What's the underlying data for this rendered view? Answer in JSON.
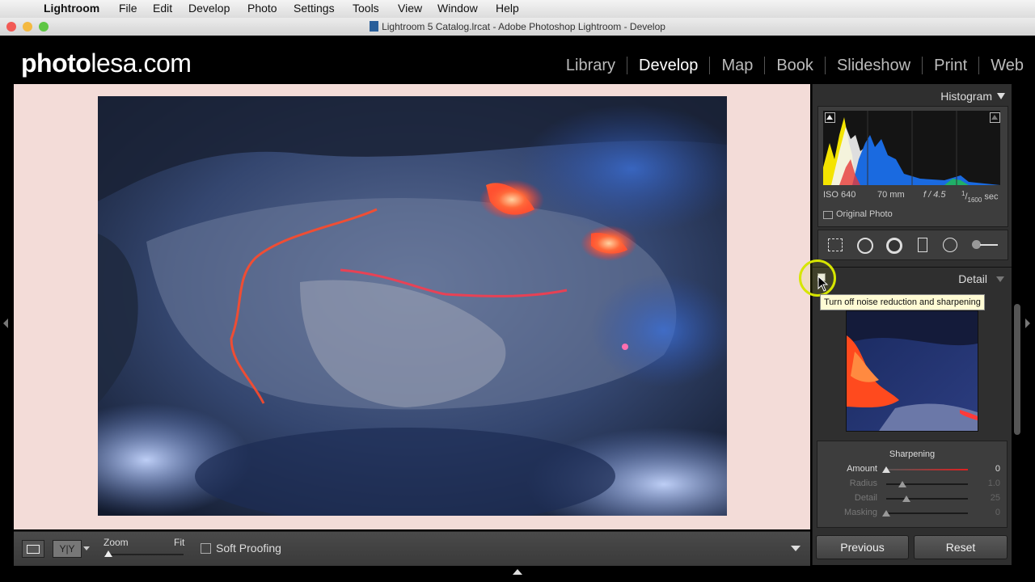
{
  "menubar": {
    "app_name": "Lightroom",
    "items": [
      "File",
      "Edit",
      "Develop",
      "Photo",
      "Settings",
      "Tools",
      "View",
      "Window",
      "Help"
    ]
  },
  "window": {
    "title": "Lightroom 5 Catalog.lrcat - Adobe Photoshop Lightroom - Develop"
  },
  "branding": {
    "logo_bold": "photo",
    "logo_rest": "lesa.com"
  },
  "modules": [
    "Library",
    "Develop",
    "Map",
    "Book",
    "Slideshow",
    "Print",
    "Web"
  ],
  "active_module": "Develop",
  "histogram": {
    "title": "Histogram",
    "iso": "ISO 640",
    "focal": "70 mm",
    "aperture": "f / 4.5",
    "shutter_num": "1",
    "shutter_den": "1600",
    "shutter_unit": "sec",
    "original_photo_label": "Original Photo"
  },
  "tool_icons": [
    "crop-overlay-icon",
    "spot-removal-icon",
    "red-eye-icon",
    "graduated-filter-icon",
    "radial-filter-icon",
    "adjustment-brush-icon"
  ],
  "detail": {
    "title": "Detail",
    "tooltip": "Turn off noise reduction and sharpening",
    "sharpening_title": "Sharpening",
    "sliders": [
      {
        "label": "Amount",
        "value": "0",
        "fraction": 0.0
      },
      {
        "label": "Radius",
        "value": "1.0",
        "fraction": 0.2
      },
      {
        "label": "Detail",
        "value": "25",
        "fraction": 0.25
      },
      {
        "label": "Masking",
        "value": "0",
        "fraction": 0.0
      }
    ]
  },
  "toolbar": {
    "zoom_label": "Zoom",
    "fit_label": "Fit",
    "soft_proofing_label": "Soft Proofing",
    "compare_label": "Y|Y"
  },
  "buttons": {
    "previous": "Previous",
    "reset": "Reset"
  },
  "colors": {
    "canvas_bg": "#f3dcd8",
    "panel_bg": "#2f2f2f",
    "lava": "#ff4a2a",
    "highlight_ring": "#d6e600"
  }
}
